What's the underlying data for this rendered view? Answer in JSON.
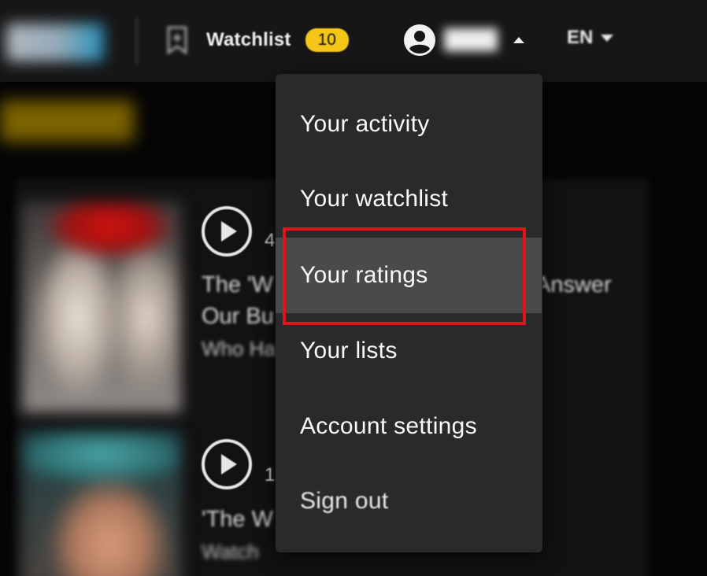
{
  "header": {
    "watchlist_label": "Watchlist",
    "watchlist_count": "10",
    "language": "EN"
  },
  "background": {
    "item1": {
      "meta": "4",
      "title_line1_left": "The 'W",
      "title_line1_right": "Answer",
      "title_line2": "Our Bu",
      "subtitle": "Who Ha"
    },
    "item2": {
      "meta": "1",
      "title_line1": "'The W",
      "subtitle": "Watch"
    }
  },
  "menu": {
    "items": [
      {
        "label": "Your activity"
      },
      {
        "label": "Your watchlist"
      },
      {
        "label": "Your ratings"
      },
      {
        "label": "Your lists"
      },
      {
        "label": "Account settings"
      },
      {
        "label": "Sign out"
      }
    ],
    "highlighted_index": 2
  },
  "colors": {
    "accent": "#f5c518",
    "menu_bg": "#2a2a2a",
    "menu_hover": "#4a4a4a",
    "annotation": "#e3121b"
  }
}
